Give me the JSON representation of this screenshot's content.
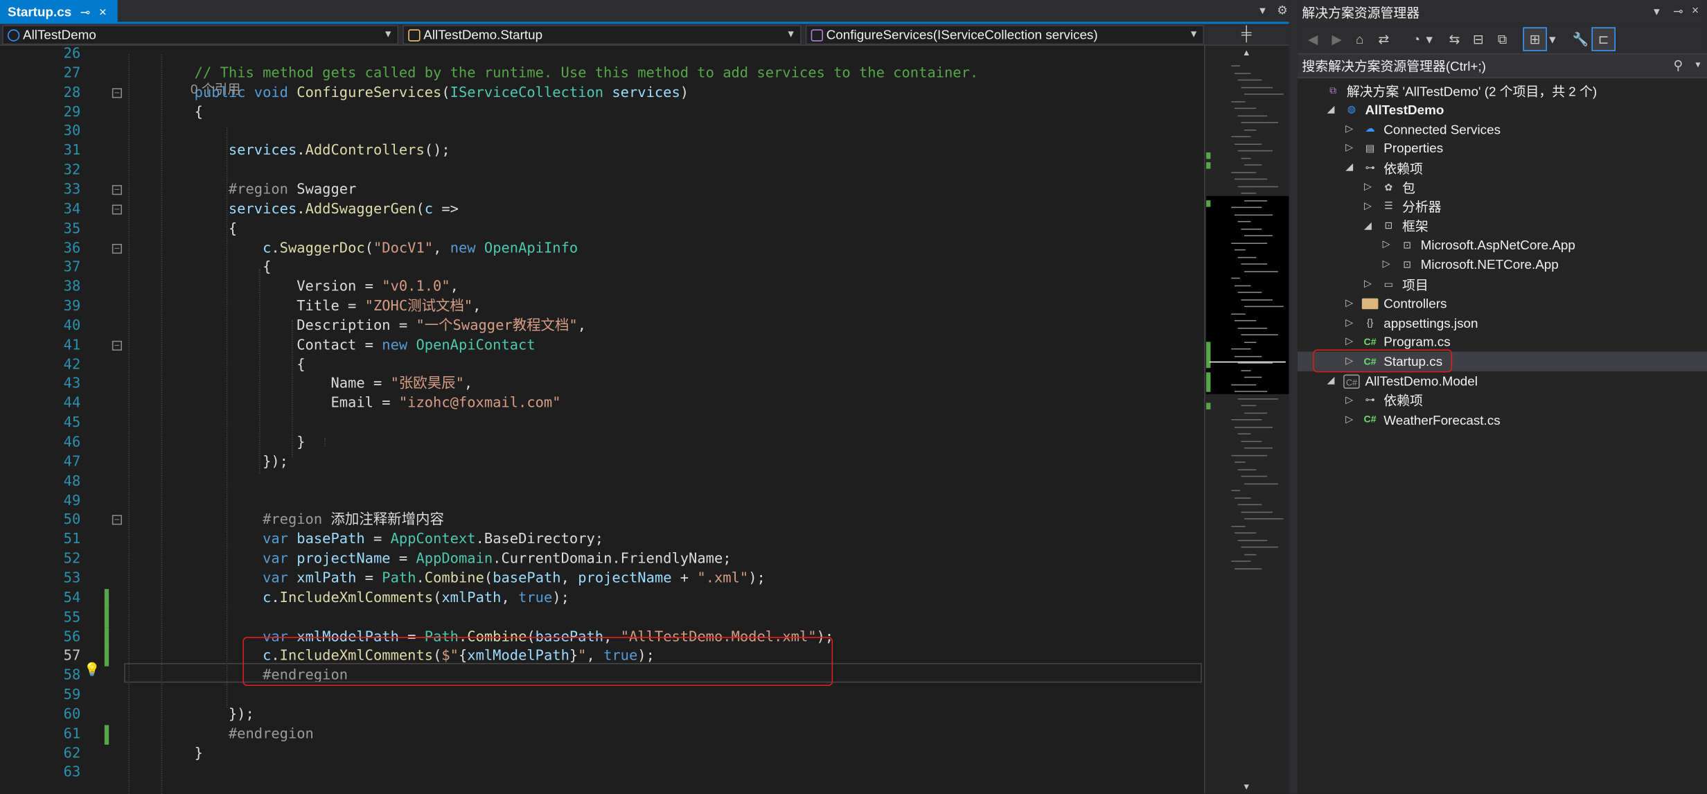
{
  "tab": {
    "title": "Startup.cs",
    "pin": "⊸",
    "close": "×"
  },
  "tab_controls": {
    "dropdown": "▾",
    "settings": "⚙"
  },
  "nav": {
    "project": "AllTestDemo",
    "class": "AllTestDemo.Startup",
    "member": "ConfigureServices(IServiceCollection services)"
  },
  "annotations": {
    "refs": "0 个引用"
  },
  "code": [
    {
      "n": "26",
      "t": []
    },
    {
      "n": "27",
      "t": [
        [
          "cm",
          "        // This method gets called by the runtime. Use this method to add services to the container."
        ]
      ]
    },
    {
      "n": "28",
      "t": [
        [
          "kw",
          "        public void "
        ],
        [
          "mt",
          "ConfigureServices"
        ],
        [
          "",
          "("
        ],
        [
          "ty",
          "IServiceCollection"
        ],
        [
          "id",
          " services"
        ],
        [
          "",
          ")"
        ]
      ]
    },
    {
      "n": "29",
      "t": [
        [
          "",
          "        {"
        ]
      ]
    },
    {
      "n": "30",
      "t": []
    },
    {
      "n": "31",
      "t": [
        [
          "id",
          "            services"
        ],
        [
          "",
          "."
        ],
        [
          "mt",
          "AddControllers"
        ],
        [
          "",
          "();"
        ]
      ]
    },
    {
      "n": "32",
      "t": []
    },
    {
      "n": "33",
      "t": [
        [
          "pp",
          "            #region "
        ],
        [
          "",
          "Swagger"
        ]
      ]
    },
    {
      "n": "34",
      "t": [
        [
          "id",
          "            services"
        ],
        [
          "",
          "."
        ],
        [
          "mt",
          "AddSwaggerGen"
        ],
        [
          "",
          "("
        ],
        [
          "id",
          "c"
        ],
        [
          "",
          " =>"
        ]
      ]
    },
    {
      "n": "35",
      "t": [
        [
          "",
          "            {"
        ]
      ]
    },
    {
      "n": "36",
      "t": [
        [
          "id",
          "                c"
        ],
        [
          "",
          "."
        ],
        [
          "mt",
          "SwaggerDoc"
        ],
        [
          "",
          "("
        ],
        [
          "st",
          "\"DocV1\""
        ],
        [
          "",
          ", "
        ],
        [
          "kw",
          "new "
        ],
        [
          "ty",
          "OpenApiInfo"
        ]
      ]
    },
    {
      "n": "37",
      "t": [
        [
          "",
          "                {"
        ]
      ]
    },
    {
      "n": "38",
      "t": [
        [
          "",
          "                    Version = "
        ],
        [
          "st",
          "\"v0.1.0\""
        ],
        [
          "",
          ","
        ]
      ]
    },
    {
      "n": "39",
      "t": [
        [
          "",
          "                    Title = "
        ],
        [
          "st",
          "\"ZOHC测试文档\""
        ],
        [
          "",
          ","
        ]
      ]
    },
    {
      "n": "40",
      "t": [
        [
          "",
          "                    Description = "
        ],
        [
          "st",
          "\"一个Swagger教程文档\""
        ],
        [
          "",
          ","
        ]
      ]
    },
    {
      "n": "41",
      "t": [
        [
          "",
          "                    Contact = "
        ],
        [
          "kw",
          "new "
        ],
        [
          "ty",
          "OpenApiContact"
        ]
      ]
    },
    {
      "n": "42",
      "t": [
        [
          "",
          "                    {"
        ]
      ]
    },
    {
      "n": "43",
      "t": [
        [
          "",
          "                        Name = "
        ],
        [
          "st",
          "\"张欧昊辰\""
        ],
        [
          "",
          ","
        ]
      ]
    },
    {
      "n": "44",
      "t": [
        [
          "",
          "                        Email = "
        ],
        [
          "st",
          "\"izohc@foxmail.com\""
        ]
      ]
    },
    {
      "n": "45",
      "t": []
    },
    {
      "n": "46",
      "t": [
        [
          "",
          "                    }"
        ]
      ]
    },
    {
      "n": "47",
      "t": [
        [
          "",
          "                });"
        ]
      ]
    },
    {
      "n": "48",
      "t": []
    },
    {
      "n": "49",
      "t": []
    },
    {
      "n": "50",
      "t": [
        [
          "pp",
          "                #region "
        ],
        [
          "",
          "添加注释新增内容"
        ]
      ]
    },
    {
      "n": "51",
      "t": [
        [
          "kw",
          "                var "
        ],
        [
          "id",
          "basePath"
        ],
        [
          "",
          " = "
        ],
        [
          "ty",
          "AppContext"
        ],
        [
          "",
          ".BaseDirectory;"
        ]
      ]
    },
    {
      "n": "52",
      "t": [
        [
          "kw",
          "                var "
        ],
        [
          "id",
          "projectName"
        ],
        [
          "",
          " = "
        ],
        [
          "ty",
          "AppDomain"
        ],
        [
          "",
          ".CurrentDomain.FriendlyName;"
        ]
      ]
    },
    {
      "n": "53",
      "t": [
        [
          "kw",
          "                var "
        ],
        [
          "id",
          "xmlPath"
        ],
        [
          "",
          " = "
        ],
        [
          "ty",
          "Path"
        ],
        [
          "",
          "."
        ],
        [
          "mt",
          "Combine"
        ],
        [
          "",
          "("
        ],
        [
          "id",
          "basePath"
        ],
        [
          "",
          ", "
        ],
        [
          "id",
          "projectName"
        ],
        [
          "",
          " + "
        ],
        [
          "st",
          "\".xml\""
        ],
        [
          "",
          ");"
        ]
      ]
    },
    {
      "n": "54",
      "t": [
        [
          "id",
          "                c"
        ],
        [
          "",
          "."
        ],
        [
          "mt",
          "IncludeXmlComments"
        ],
        [
          "",
          "("
        ],
        [
          "id",
          "xmlPath"
        ],
        [
          "",
          ", "
        ],
        [
          "kw",
          "true"
        ],
        [
          "",
          ");"
        ]
      ]
    },
    {
      "n": "55",
      "t": []
    },
    {
      "n": "56",
      "t": [
        [
          "kw",
          "                var "
        ],
        [
          "id",
          "xmlModelPath"
        ],
        [
          "",
          " = "
        ],
        [
          "ty",
          "Path"
        ],
        [
          "",
          "."
        ],
        [
          "mt",
          "Combine"
        ],
        [
          "",
          "("
        ],
        [
          "id",
          "basePath"
        ],
        [
          "",
          ", "
        ],
        [
          "st",
          "\"AllTestDemo.Model.xml\""
        ],
        [
          "",
          ");"
        ]
      ]
    },
    {
      "n": "57",
      "t": [
        [
          "id",
          "                c"
        ],
        [
          "",
          "."
        ],
        [
          "mt",
          "IncludeXmlComments"
        ],
        [
          "",
          "("
        ],
        [
          "st",
          "$\""
        ],
        [
          "",
          "{"
        ],
        [
          "id",
          "xmlModelPath"
        ],
        [
          "",
          "}"
        ],
        [
          "st",
          "\""
        ],
        [
          "",
          ", "
        ],
        [
          "kw",
          "true"
        ],
        [
          "",
          ");"
        ]
      ]
    },
    {
      "n": "58",
      "t": [
        [
          "pp",
          "                #endregion"
        ]
      ]
    },
    {
      "n": "59",
      "t": []
    },
    {
      "n": "60",
      "t": [
        [
          "",
          "            });"
        ]
      ]
    },
    {
      "n": "61",
      "t": [
        [
          "pp",
          "            #endregion"
        ]
      ]
    },
    {
      "n": "62",
      "t": [
        [
          "",
          "        }"
        ]
      ]
    },
    {
      "n": "63",
      "t": []
    }
  ],
  "current_line": "57",
  "collapsible_lines": [
    "28",
    "33",
    "34",
    "36",
    "41",
    "50"
  ],
  "changed_lines": [
    "54",
    "55",
    "56",
    "57",
    "61"
  ],
  "solution_explorer": {
    "title": "解决方案资源管理器",
    "search_placeholder": "搜索解决方案资源管理器(Ctrl+;)",
    "nodes": [
      {
        "label": "解决方案 'AllTestDemo' (2 个项目，共 2 个)",
        "icon": "sln-icon",
        "glyph": "⧉",
        "depth": 0,
        "exp": "",
        "bold": false
      },
      {
        "label": "AllTestDemo",
        "icon": "web-project-icon",
        "glyph": "◍",
        "depth": 1,
        "exp": "◢",
        "bold": true
      },
      {
        "label": "Connected Services",
        "icon": "connected-services-icon",
        "glyph": "☁",
        "depth": 2,
        "exp": "▷",
        "bold": false
      },
      {
        "label": "Properties",
        "icon": "properties-icon",
        "glyph": "▤",
        "depth": 2,
        "exp": "▷",
        "bold": false
      },
      {
        "label": "依赖项",
        "icon": "dependencies-icon",
        "glyph": "⊶",
        "depth": 2,
        "exp": "◢",
        "bold": false
      },
      {
        "label": "包",
        "icon": "package-icon",
        "glyph": "✿",
        "depth": 3,
        "exp": "▷",
        "bold": false
      },
      {
        "label": "分析器",
        "icon": "analyzer-icon",
        "glyph": "☰",
        "depth": 3,
        "exp": "▷",
        "bold": false
      },
      {
        "label": "框架",
        "icon": "framework-icon",
        "glyph": "⊡",
        "depth": 3,
        "exp": "◢",
        "bold": false
      },
      {
        "label": "Microsoft.AspNetCore.App",
        "icon": "framework-ref-icon",
        "glyph": "⊡",
        "depth": 4,
        "exp": "▷",
        "bold": false
      },
      {
        "label": "Microsoft.NETCore.App",
        "icon": "framework-ref-icon",
        "glyph": "⊡",
        "depth": 4,
        "exp": "▷",
        "bold": false
      },
      {
        "label": "项目",
        "icon": "project-ref-icon",
        "glyph": "▭",
        "depth": 3,
        "exp": "▷",
        "bold": false
      },
      {
        "label": "Controllers",
        "icon": "folder-icon",
        "glyph": "",
        "depth": 2,
        "exp": "▷",
        "bold": false
      },
      {
        "label": "appsettings.json",
        "icon": "json-icon",
        "glyph": "{}",
        "depth": 2,
        "exp": "▷",
        "bold": false
      },
      {
        "label": "Program.cs",
        "icon": "csharp-file-icon",
        "glyph": "C#",
        "depth": 2,
        "exp": "▷",
        "bold": false
      },
      {
        "label": "Startup.cs",
        "icon": "csharp-file-icon",
        "glyph": "C#",
        "depth": 2,
        "exp": "▷",
        "bold": false
      },
      {
        "label": "AllTestDemo.Model",
        "icon": "csharp-project-icon",
        "glyph": "C#",
        "depth": 1,
        "exp": "◢",
        "bold": false
      },
      {
        "label": "依赖项",
        "icon": "dependencies-icon",
        "glyph": "⊶",
        "depth": 2,
        "exp": "▷",
        "bold": false
      },
      {
        "label": "WeatherForecast.cs",
        "icon": "csharp-file-icon",
        "glyph": "C#",
        "depth": 2,
        "exp": "▷",
        "bold": false
      }
    ]
  }
}
